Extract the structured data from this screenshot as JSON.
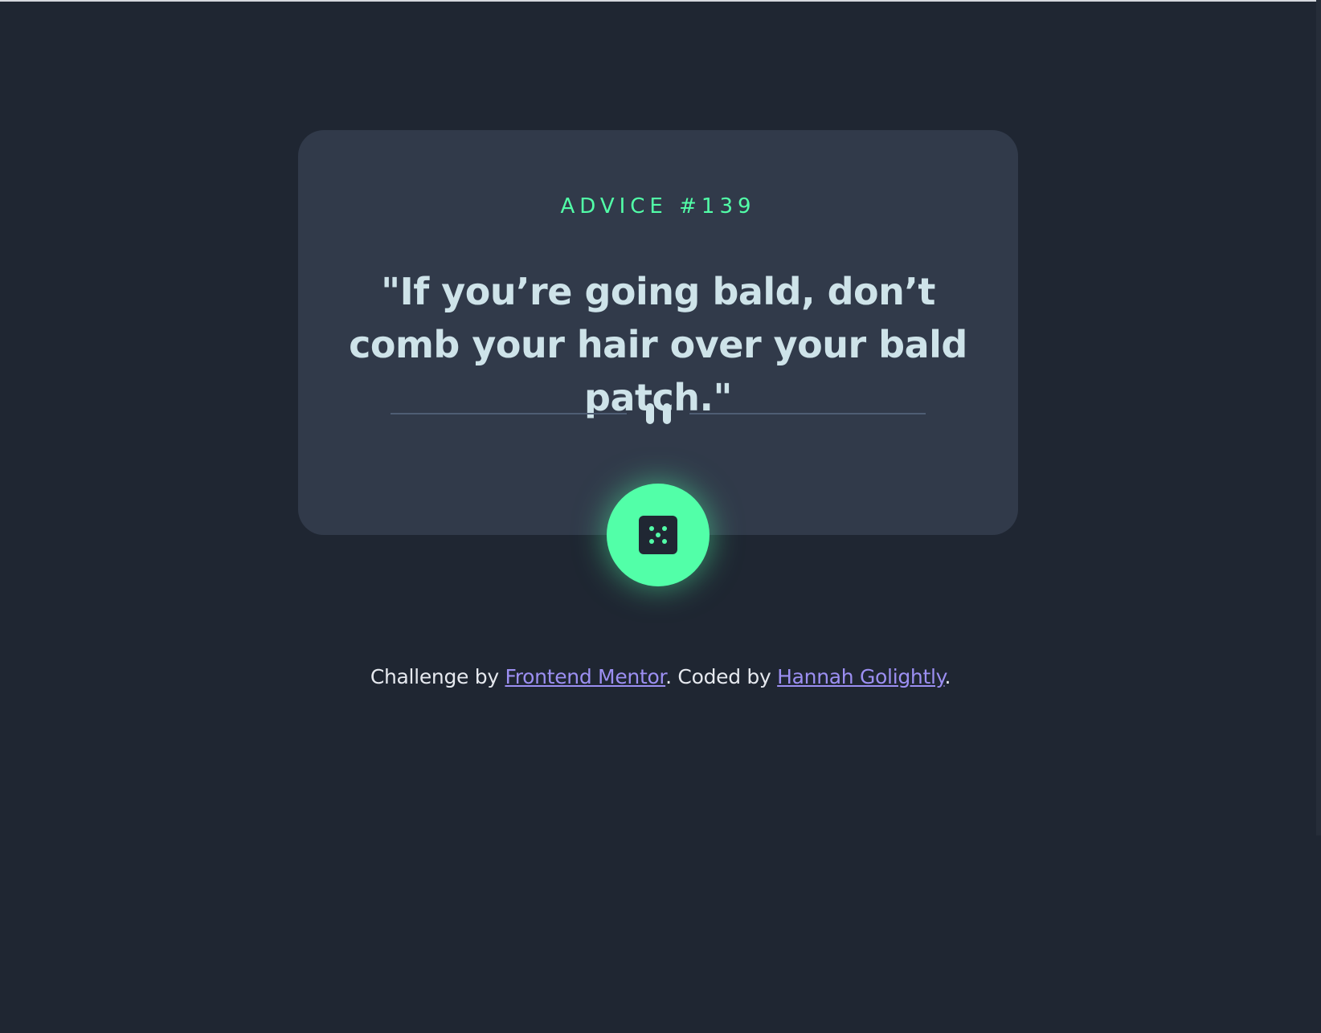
{
  "card": {
    "advice_label": "ADVICE #139",
    "advice_text": "\"If you’re going bald, don’t comb your hair over your bald patch.\""
  },
  "divider": {
    "icon": "pause-icon"
  },
  "dice_button": {
    "icon": "dice-icon"
  },
  "footer": {
    "prefix": "Challenge by ",
    "link1": "Frontend Mentor",
    "middle": ". Coded by ",
    "link2": "Hannah Golightly",
    "suffix": "."
  },
  "colors": {
    "background": "#1f2632",
    "card": "#313a4a",
    "accent_green": "#52ffa8",
    "text_light": "#cee3e9",
    "link_purple": "#9c8ff2"
  }
}
